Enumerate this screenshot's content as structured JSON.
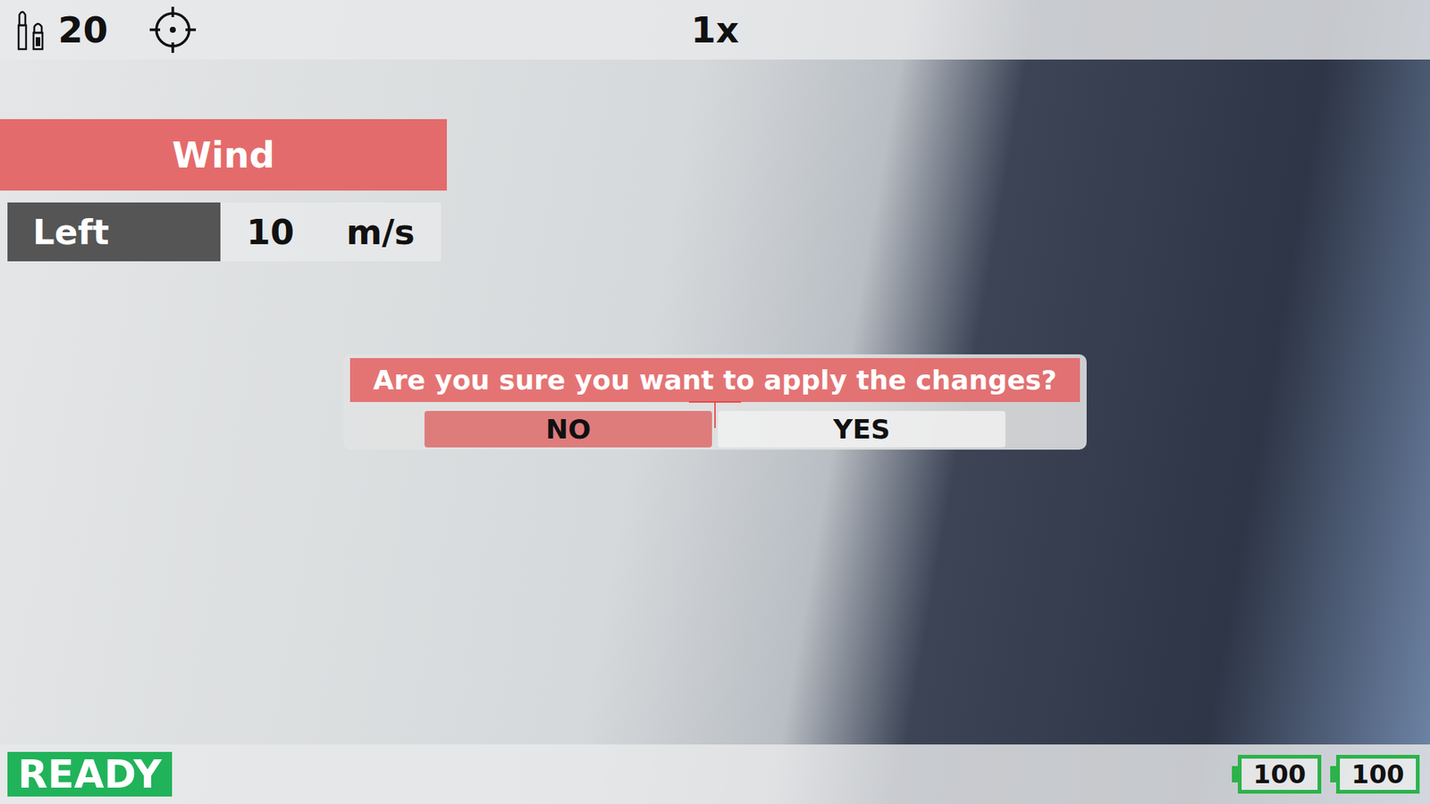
{
  "hud": {
    "ammo": "20",
    "zoom": "1x",
    "status": "READY",
    "indicators": [
      {
        "value": "100"
      },
      {
        "value": "100"
      }
    ]
  },
  "wind_panel": {
    "title": "Wind",
    "direction": "Left",
    "speed": "10",
    "unit": "m/s"
  },
  "dialog": {
    "question": "Are you sure you want to apply the changes?",
    "buttons": [
      {
        "label": "NO",
        "selected": true
      },
      {
        "label": "YES",
        "selected": false
      }
    ]
  }
}
